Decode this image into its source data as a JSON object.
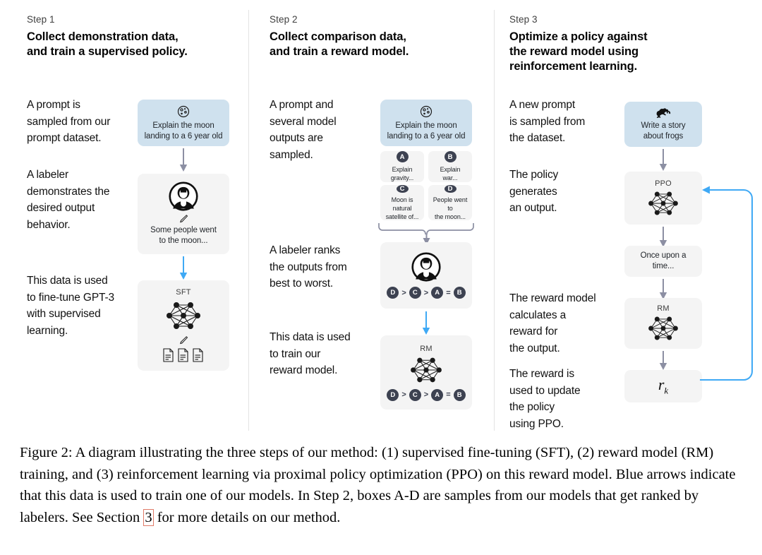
{
  "figure": {
    "columns": [
      {
        "step_label": "Step 1",
        "title_line1": "Collect demonstration data,",
        "title_line2": "and train a supervised policy.",
        "descriptions": [
          "A prompt is\nsampled from our\nprompt dataset.",
          "A labeler\ndemonstrates the\ndesired output\nbehavior.",
          "This data is used\nto fine-tune GPT-3\nwith supervised\nlearning."
        ],
        "cards": [
          {
            "name": "prompt-card",
            "kind": "blue",
            "icon": "moon-icon",
            "text": "Explain the moon\nlanding to a 6 year old"
          },
          {
            "name": "labeler-demo-card",
            "kind": "grey",
            "icon": "labeler-person-icon",
            "text": "Some people went\nto the moon..."
          },
          {
            "name": "sft-model-card",
            "kind": "grey",
            "icon": "neural-net-icon",
            "title": "SFT",
            "text": ""
          }
        ]
      },
      {
        "step_label": "Step 2",
        "title_line1": "Collect comparison data,",
        "title_line2": "and train a reward model.",
        "descriptions": [
          "A prompt and\nseveral model\noutputs are\nsampled.",
          "A labeler ranks\nthe outputs from\nbest to worst.",
          "This data is used\nto train our\nreward model."
        ],
        "cards": [
          {
            "name": "prompt-card",
            "kind": "blue",
            "icon": "moon-icon",
            "text": "Explain the moon\nlanding to a 6 year old"
          },
          {
            "name": "sample-card-a",
            "kind": "grey",
            "badge": "A",
            "text": "Explain gravity..."
          },
          {
            "name": "sample-card-b",
            "kind": "grey",
            "badge": "B",
            "text": "Explain war..."
          },
          {
            "name": "sample-card-c",
            "kind": "grey",
            "badge": "C",
            "text": "Moon is natural\nsatellite of..."
          },
          {
            "name": "sample-card-d",
            "kind": "grey",
            "badge": "D",
            "text": "People went to\nthe moon..."
          },
          {
            "name": "labeler-rank-card",
            "kind": "grey",
            "icon": "labeler-person-icon",
            "ranking": "D > C > A = B"
          },
          {
            "name": "reward-model-card",
            "kind": "grey",
            "icon": "neural-net-icon",
            "title": "RM",
            "ranking": "D > C > A = B"
          }
        ],
        "ranking": [
          "D",
          ">",
          "C",
          ">",
          "A",
          "=",
          "B"
        ]
      },
      {
        "step_label": "Step 3",
        "title_line1": "Optimize a policy against",
        "title_line2": "the reward model using",
        "title_line3": "reinforcement learning.",
        "descriptions": [
          "A new prompt\nis sampled from\nthe dataset.",
          "The policy\ngenerates\nan output.",
          "The reward model\ncalculates a\nreward for\nthe output.",
          "The reward is\nused to update\nthe policy\nusing PPO."
        ],
        "cards": [
          {
            "name": "new-prompt-card",
            "kind": "blue",
            "icon": "frog-icon",
            "text": "Write a story\nabout frogs"
          },
          {
            "name": "ppo-policy-card",
            "kind": "grey",
            "icon": "neural-net-icon",
            "title": "PPO"
          },
          {
            "name": "output-text-card",
            "kind": "grey",
            "text": "Once upon a time..."
          },
          {
            "name": "reward-model-card",
            "kind": "grey",
            "icon": "neural-net-icon",
            "title": "RM"
          },
          {
            "name": "reward-value-card",
            "kind": "grey",
            "formula_base": "r",
            "formula_sub": "k"
          }
        ]
      }
    ]
  },
  "caption": {
    "part1": "Figure 2: A diagram illustrating the three steps of our method: (1) supervised fine-tuning (SFT), (2) reward model (RM) training, and (3) reinforcement learning via proximal policy optimization (PPO) on this reward model. Blue arrows indicate that this data is used to train one of our models. In Step 2, boxes A-D are samples from our models that get ranked by labelers. See Section ",
    "section_ref": "3",
    "part2": " for more details on our method."
  },
  "colors": {
    "blue_card": "#cfe1ee",
    "grey_card": "#f4f4f4",
    "grey_arrow": "#8c8fa3",
    "blue_arrow": "#3fa9f5",
    "badge": "#3d4251",
    "section_ref_border": "#e07a68"
  }
}
